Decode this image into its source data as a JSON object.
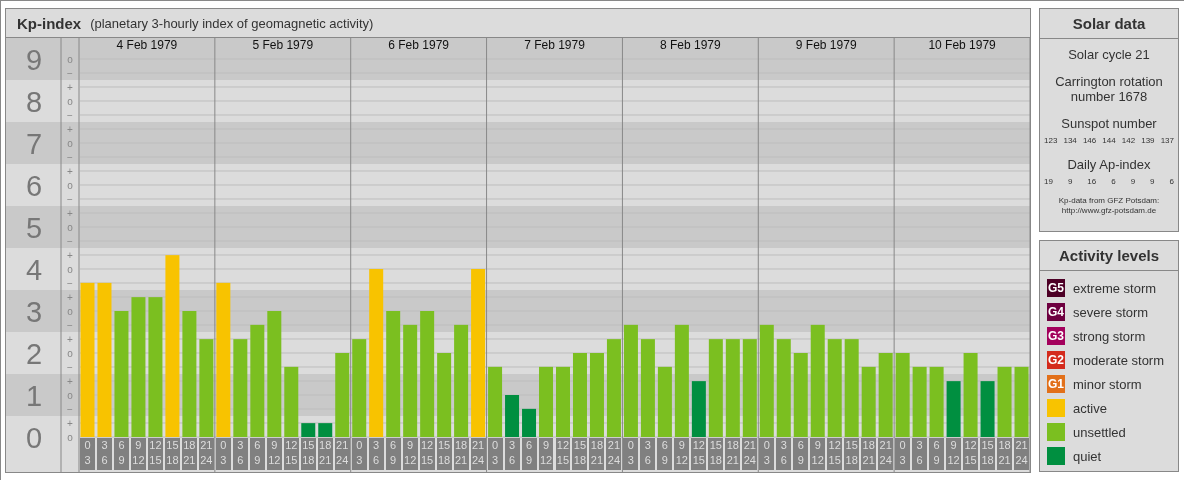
{
  "kp_panel": {
    "title": "Kp-index",
    "subtitle": "(planetary 3-hourly index of geomagnetic activity)",
    "dates": [
      "4 Feb 1979",
      "5 Feb 1979",
      "6 Feb 1979",
      "7 Feb 1979",
      "8 Feb 1979",
      "9 Feb 1979",
      "10 Feb 1979"
    ],
    "minor_ticks": [
      "o",
      "−",
      "+",
      "o",
      "−",
      "+",
      "o",
      "−",
      "+",
      "o",
      "−",
      "+",
      "o",
      "−",
      "+",
      "o",
      "−",
      "+",
      "o",
      "−",
      "+",
      "o",
      "−",
      "+",
      "o",
      "−",
      "+",
      "o"
    ],
    "chart_data": {
      "type": "bar",
      "stacked": true,
      "grid": true,
      "ylim": [
        0,
        9.5
      ],
      "yticks": [
        0,
        1,
        2,
        3,
        4,
        5,
        6,
        7,
        8,
        9
      ],
      "categories": [
        "0\n3",
        "3\n6",
        "6\n9",
        "9\n12",
        "12\n15",
        "15\n18",
        "18\n21",
        "21\n24",
        "0\n3",
        "3\n6",
        "6\n9",
        "9\n12",
        "12\n15",
        "15\n18",
        "18\n21",
        "21\n24",
        "0\n3",
        "3\n6",
        "6\n9",
        "9\n12",
        "12\n15",
        "15\n18",
        "18\n21",
        "21\n24",
        "0\n3",
        "3\n6",
        "6\n9",
        "9\n12",
        "12\n15",
        "15\n18",
        "18\n21",
        "21\n24",
        "0\n3",
        "3\n6",
        "6\n9",
        "9\n12",
        "12\n15",
        "15\n18",
        "18\n21",
        "21\n24",
        "0\n3",
        "3\n6",
        "6\n9",
        "9\n12",
        "12\n15",
        "15\n18",
        "18\n21",
        "21\n24",
        "0\n3",
        "3\n6",
        "6\n9",
        "9\n12",
        "12\n15",
        "15\n18",
        "18\n21",
        "21\n24"
      ],
      "series": [
        {
          "name": "active",
          "color": "#f8c300",
          "values": [
            3.67,
            3.67,
            null,
            null,
            null,
            4.33,
            null,
            null,
            3.67,
            null,
            null,
            null,
            null,
            null,
            null,
            null,
            null,
            4,
            null,
            null,
            null,
            null,
            null,
            4,
            null,
            null,
            null,
            null,
            null,
            null,
            null,
            null,
            null,
            null,
            null,
            null,
            null,
            null,
            null,
            null,
            null,
            null,
            null,
            null,
            null,
            null,
            null,
            null,
            null,
            null,
            null,
            null,
            null,
            null,
            null,
            null
          ]
        },
        {
          "name": "unsettled",
          "color": "#7bbf20",
          "values": [
            null,
            null,
            3,
            3.33,
            3.33,
            null,
            3,
            2.33,
            null,
            2.33,
            2.67,
            3,
            1.67,
            null,
            null,
            2,
            2.33,
            null,
            3,
            2.67,
            3,
            2,
            2.67,
            null,
            1.67,
            null,
            null,
            1.67,
            1.67,
            2,
            2,
            2.33,
            2.67,
            2.33,
            1.67,
            2.67,
            null,
            2.33,
            2.33,
            2.33,
            2.67,
            2.33,
            2,
            2.67,
            2.33,
            2.33,
            1.67,
            2,
            2,
            1.67,
            1.67,
            null,
            2,
            null,
            1.67,
            1.67
          ]
        },
        {
          "name": "quiet",
          "color": "#008f40",
          "values": [
            null,
            null,
            null,
            null,
            null,
            null,
            null,
            null,
            null,
            null,
            null,
            null,
            null,
            0.33,
            0.33,
            null,
            null,
            null,
            null,
            null,
            null,
            null,
            null,
            null,
            null,
            1,
            0.67,
            null,
            null,
            null,
            null,
            null,
            null,
            null,
            null,
            null,
            1.33,
            null,
            null,
            null,
            null,
            null,
            null,
            null,
            null,
            null,
            null,
            null,
            null,
            null,
            null,
            1.33,
            null,
            1.33,
            null,
            null
          ]
        }
      ]
    }
  },
  "solar_data": {
    "title": "Solar data",
    "solar_cycle": "Solar cycle 21",
    "carrington": "Carrington rotation number 1678",
    "sunspot_label": "Sunspot number",
    "sunspot_numbers": [
      "123",
      "134",
      "146",
      "144",
      "142",
      "139",
      "137"
    ],
    "ap_label": "Daily Ap-index",
    "ap_values": [
      "19",
      "9",
      "16",
      "6",
      "9",
      "9",
      "6"
    ],
    "source": "Kp-data from GFZ Potsdam:",
    "source_url": "http://www.gfz-potsdam.de"
  },
  "activity_levels": {
    "title": "Activity levels",
    "items": [
      {
        "badge": "G5",
        "label": "extreme storm",
        "color": "#4d0026"
      },
      {
        "badge": "G4",
        "label": "severe storm",
        "color": "#6e0040"
      },
      {
        "badge": "G3",
        "label": "strong storm",
        "color": "#a3005c"
      },
      {
        "badge": "G2",
        "label": "moderate storm",
        "color": "#d42a1c"
      },
      {
        "badge": "G1",
        "label": "minor storm",
        "color": "#e2701a"
      }
    ]
  }
}
